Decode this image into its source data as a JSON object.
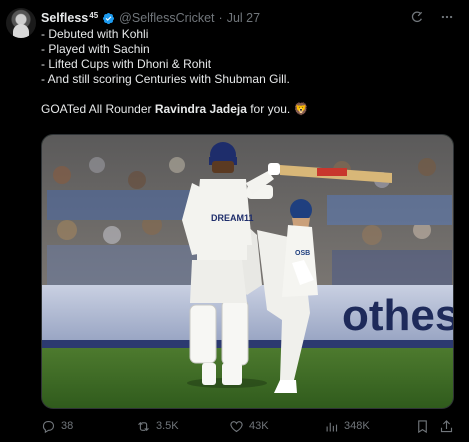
{
  "tweet": {
    "author": {
      "name": "Selfless",
      "name_superscript": "45",
      "handle": "@SelflessCricket",
      "date": "Jul 27",
      "dot": "·"
    },
    "lines": [
      "- Debuted with Kohli",
      "- Played with Sachin",
      "- Lifted Cups with Dhoni & Rohit",
      "- And still scoring Centuries with Shubman Gill."
    ],
    "closing": {
      "prefix": "GOATed All Rounder ",
      "bold": "Ravindra Jadeja",
      "suffix": " for you. ",
      "emoji": "🦁"
    },
    "media": {
      "banner_text": "othes",
      "shirt_text": "DREAM11",
      "shirt_text_2": "OSB"
    },
    "actions": {
      "replies": "38",
      "reposts": "3.5K",
      "likes": "43K",
      "views": "348K"
    }
  },
  "colors": {
    "background": "#000000",
    "text_primary": "#e7e9ea",
    "text_secondary": "#71767b",
    "verified": "#1d9bf0"
  }
}
